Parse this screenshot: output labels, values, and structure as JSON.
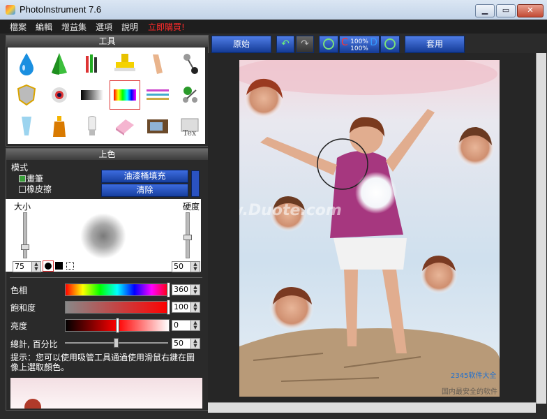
{
  "window": {
    "title": "PhotoInstrument 7.6"
  },
  "menu": [
    "檔案",
    "編輯",
    "增益集",
    "選項",
    "說明"
  ],
  "menu_register": "立即購買!",
  "tools_panel": {
    "title": "工具"
  },
  "color_panel": {
    "title": "上色",
    "mode_label": "模式",
    "brush_label": "畫筆",
    "eraser_label": "橡皮擦",
    "fill_button": "油漆桶填充",
    "clear_button": "清除",
    "size_label": "大小",
    "hardness_label": "硬度",
    "size_value": "75",
    "hardness_value": "50",
    "hue_label": "色相",
    "hue_value": "360",
    "saturation_label": "飽和度",
    "saturation_value": "100",
    "brightness_label": "亮度",
    "brightness_value": "0",
    "total_label": "總計, 百分比",
    "total_value": "50",
    "hint": "提示：您可以使用吸管工具通過使用滑鼠右鍵在圖像上選取顏色。"
  },
  "toolbar": {
    "original_button": "原始",
    "zoom_top": "100%",
    "zoom_bottom": "100%",
    "apply_button": "套用"
  },
  "watermark": "www.Duote.com",
  "corner_watermark_1": "2345软件大全",
  "corner_watermark_2": "国内最安全的软件",
  "colors": {
    "accent_blue": "#1f4fbf",
    "panel_bg": "#2a2a2a",
    "register_red": "#ff2a2a"
  }
}
